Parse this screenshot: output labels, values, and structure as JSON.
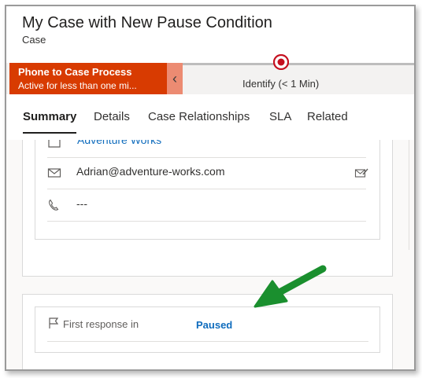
{
  "header": {
    "title": "My Case with New Pause Condition",
    "entity": "Case"
  },
  "process_bar": {
    "process_name": "Phone to Case Process",
    "process_status": "Active for less than one mi...",
    "collapse_glyph": "‹",
    "stage_label": "Identify",
    "stage_duration": "(< 1 Min)",
    "accent_color": "#d83b01",
    "marker_color": "#c50f1f"
  },
  "tabs": [
    {
      "label": "Summary",
      "active": true
    },
    {
      "label": "Details",
      "active": false
    },
    {
      "label": "Case Relationships",
      "active": false
    },
    {
      "label": "SLA",
      "active": false
    },
    {
      "label": "Related",
      "active": false
    }
  ],
  "contact_card": {
    "account": {
      "icon": "account-icon",
      "value": "Adventure Works"
    },
    "email": {
      "icon": "mail-icon",
      "value": "Adrian@adventure-works.com",
      "action_icon": "compose-email-icon"
    },
    "phone": {
      "icon": "phone-icon",
      "value": "---"
    }
  },
  "sla": {
    "icon": "flag-icon",
    "label": "First response in",
    "value": "Paused"
  },
  "annotation": {
    "icon": "green-arrow-icon",
    "color": "#1a8f2e"
  }
}
